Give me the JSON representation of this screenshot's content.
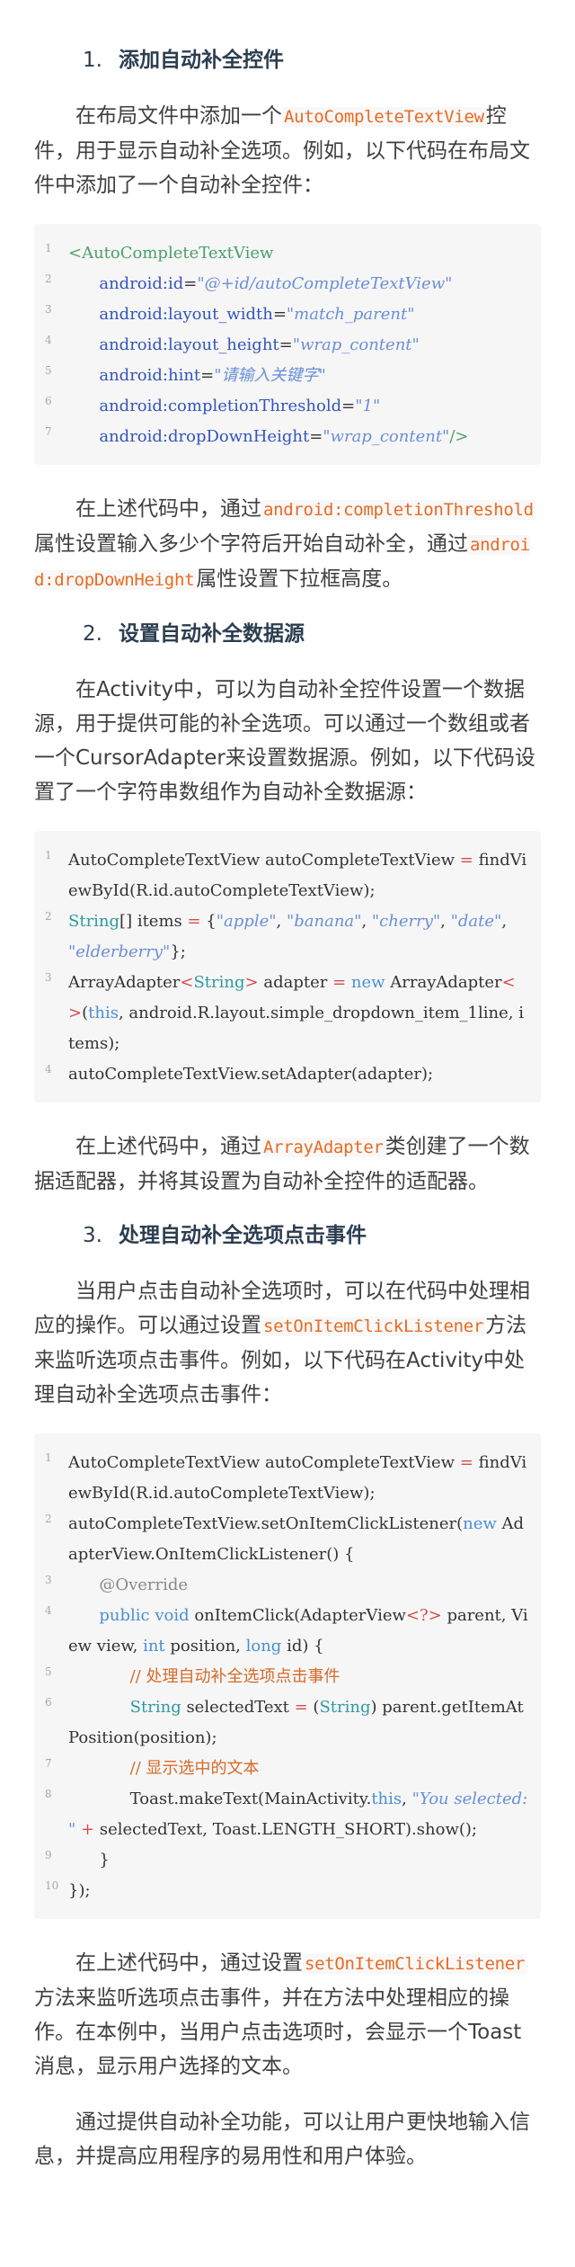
{
  "sections": [
    {
      "number": "1.",
      "title": "添加自动补全控件",
      "intro": {
        "before": "在布局文件中添加一个",
        "code": "AutoCompleteTextView",
        "after": "控件，用于显示自动补全选项。例如，以下代码在布局文件中添加了一个自动补全控件："
      },
      "code_lines": [
        {
          "no": "1",
          "parts": [
            [
              "tag",
              "<AutoCompleteTextView"
            ]
          ]
        },
        {
          "no": "2",
          "indent": "      ",
          "parts": [
            [
              "attr",
              "android:id"
            ],
            [
              "plain",
              "="
            ],
            [
              "str",
              "\"@+id/autoCompleteTextView\""
            ]
          ]
        },
        {
          "no": "3",
          "indent": "      ",
          "parts": [
            [
              "attr",
              "android:layout_width"
            ],
            [
              "plain",
              "="
            ],
            [
              "str",
              "\"match_parent\""
            ]
          ]
        },
        {
          "no": "4",
          "indent": "      ",
          "parts": [
            [
              "attr",
              "android:layout_height"
            ],
            [
              "plain",
              "="
            ],
            [
              "str",
              "\"wrap_content\""
            ]
          ]
        },
        {
          "no": "5",
          "indent": "      ",
          "parts": [
            [
              "attr",
              "android:hint"
            ],
            [
              "plain",
              "="
            ],
            [
              "str",
              "\"请输入关键字\""
            ]
          ]
        },
        {
          "no": "6",
          "indent": "      ",
          "parts": [
            [
              "attr",
              "android:completionThreshold"
            ],
            [
              "plain",
              "="
            ],
            [
              "str",
              "\"1\""
            ]
          ]
        },
        {
          "no": "7",
          "indent": "      ",
          "parts": [
            [
              "attr",
              "android:dropDownHeight"
            ],
            [
              "plain",
              "="
            ],
            [
              "str",
              "\"wrap_content\""
            ],
            [
              "tag",
              "/>"
            ]
          ]
        }
      ],
      "outro": {
        "p1": "在上述代码中，通过",
        "c1": "android:completionThreshold",
        "p2": "属性设置输入多少个字符后开始自动补全，通过",
        "c2": "android:dropDownHeight",
        "p3": "属性设置下拉框高度。"
      }
    },
    {
      "number": "2.",
      "title": "设置自动补全数据源",
      "intro": {
        "text": "在Activity中，可以为自动补全控件设置一个数据源，用于提供可能的补全选项。可以通过一个数组或者一个CursorAdapter来设置数据源。例如，以下代码设置了一个字符串数组作为自动补全数据源："
      },
      "code_lines": [
        {
          "no": "1",
          "parts": [
            [
              "plain",
              "AutoCompleteTextView autoCompleteTextView "
            ],
            [
              "op",
              "="
            ],
            [
              "plain",
              " findViewById(R.id.autoCompleteTextView);"
            ]
          ]
        },
        {
          "no": "2",
          "parts": [
            [
              "type",
              "String"
            ],
            [
              "plain",
              "[] items "
            ],
            [
              "op",
              "="
            ],
            [
              "plain",
              " {"
            ],
            [
              "str",
              "\"apple\""
            ],
            [
              "plain",
              ", "
            ],
            [
              "str",
              "\"banana\""
            ],
            [
              "plain",
              ", "
            ],
            [
              "str",
              "\"cherry\""
            ],
            [
              "plain",
              ", "
            ],
            [
              "str",
              "\"date\""
            ],
            [
              "plain",
              ", "
            ],
            [
              "str",
              "\"elderberry\""
            ],
            [
              "plain",
              "};"
            ]
          ]
        },
        {
          "no": "3",
          "parts": [
            [
              "plain",
              "ArrayAdapter"
            ],
            [
              "op",
              "<"
            ],
            [
              "type",
              "String"
            ],
            [
              "op",
              ">"
            ],
            [
              "plain",
              " adapter "
            ],
            [
              "op",
              "="
            ],
            [
              "plain",
              " "
            ],
            [
              "kw",
              "new"
            ],
            [
              "plain",
              " ArrayAdapter"
            ],
            [
              "op",
              "<>"
            ],
            [
              "plain",
              "("
            ],
            [
              "kw",
              "this"
            ],
            [
              "plain",
              ", android.R.layout.simple_dropdown_item_1line, items);"
            ]
          ]
        },
        {
          "no": "4",
          "parts": [
            [
              "plain",
              "autoCompleteTextView.setAdapter(adapter);"
            ]
          ]
        }
      ],
      "outro": {
        "p1": "在上述代码中，通过",
        "c1": "ArrayAdapter",
        "p2": "类创建了一个数据适配器，并将其设置为自动补全控件的适配器。"
      }
    },
    {
      "number": "3.",
      "title": "处理自动补全选项点击事件",
      "intro": {
        "before": "当用户点击自动补全选项时，可以在代码中处理相应的操作。可以通过设置",
        "code": "setOnItemClickListener",
        "after": "方法来监听选项点击事件。例如，以下代码在Activity中处理自动补全选项点击事件："
      },
      "code_lines": [
        {
          "no": "1",
          "parts": [
            [
              "plain",
              "AutoCompleteTextView autoCompleteTextView "
            ],
            [
              "op",
              "="
            ],
            [
              "plain",
              " findViewById(R.id.autoCompleteTextView);"
            ]
          ]
        },
        {
          "no": "2",
          "parts": [
            [
              "plain",
              "autoCompleteTextView.setOnItemClickListener("
            ],
            [
              "kw",
              "new"
            ],
            [
              "plain",
              " AdapterView.OnItemClickListener() {"
            ]
          ]
        },
        {
          "no": "3",
          "indent": "      ",
          "parts": [
            [
              "ann",
              "@Override"
            ]
          ]
        },
        {
          "no": "4",
          "indent": "      ",
          "parts": [
            [
              "kw",
              "public"
            ],
            [
              "plain",
              " "
            ],
            [
              "kw",
              "void"
            ],
            [
              "plain",
              " onItemClick(AdapterView"
            ],
            [
              "op",
              "<?>"
            ],
            [
              "plain",
              " parent, View view, "
            ],
            [
              "kw",
              "int"
            ],
            [
              "plain",
              " position, "
            ],
            [
              "kw",
              "long"
            ],
            [
              "plain",
              " id) {"
            ]
          ]
        },
        {
          "no": "5",
          "indent": "            ",
          "parts": [
            [
              "cm",
              "// 处理自动补全选项点击事件"
            ]
          ]
        },
        {
          "no": "6",
          "indent": "            ",
          "parts": [
            [
              "type",
              "String"
            ],
            [
              "plain",
              " selectedText "
            ],
            [
              "op",
              "="
            ],
            [
              "plain",
              " ("
            ],
            [
              "type",
              "String"
            ],
            [
              "plain",
              ") parent.getItemAtPosition(position);"
            ]
          ]
        },
        {
          "no": "7",
          "indent": "            ",
          "parts": [
            [
              "cm",
              "// 显示选中的文本"
            ]
          ]
        },
        {
          "no": "8",
          "indent": "            ",
          "parts": [
            [
              "plain",
              "Toast.makeText(MainActivity."
            ],
            [
              "kw",
              "this"
            ],
            [
              "plain",
              ", "
            ],
            [
              "str",
              "\"You selected: \""
            ],
            [
              "plain",
              " "
            ],
            [
              "op",
              "+"
            ],
            [
              "plain",
              " selectedText, Toast.LENGTH_SHORT).show();"
            ]
          ]
        },
        {
          "no": "9",
          "indent": "      ",
          "parts": [
            [
              "plain",
              "}"
            ]
          ]
        },
        {
          "no": "10",
          "parts": [
            [
              "plain",
              "});"
            ]
          ]
        }
      ],
      "outro": {
        "p1": "在上述代码中，通过设置",
        "c1": "setOnItemClickListener",
        "p2": "方法来监听选项点击事件，并在方法中处理相应的操作。在本例中，当用户点击选项时，会显示一个Toast消息，显示用户选择的文本。"
      }
    }
  ],
  "conclusion": "通过提供自动补全功能，可以让用户更快地输入信息，并提高应用程序的易用性和用户体验。"
}
